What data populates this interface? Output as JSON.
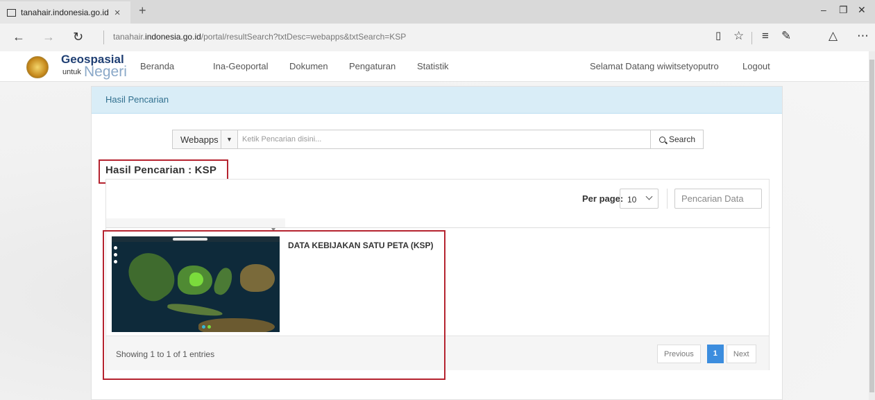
{
  "browser": {
    "tab_title": "tanahair.indonesia.go.id",
    "url_prefix": "tanahair.",
    "url_domain": "indonesia.go.id",
    "url_path": "/portal/resultSearch?txtDesc=webapps&txtSearch=KSP"
  },
  "site": {
    "brand_line1": "Geospasial",
    "brand_line2": "untuk",
    "brand_line3": "Negeri",
    "menu": [
      "Beranda",
      "Ina-Geoportal",
      "Dokumen",
      "Pengaturan",
      "Statistik"
    ],
    "welcome": "Selamat Datang wiwitsetyoputro",
    "logout": "Logout"
  },
  "card": {
    "header": "Hasil Pencarian",
    "search_type": "Webapps",
    "search_placeholder": "Ketik Pencarian disini...",
    "search_button": "Search",
    "result_title": "Hasil Pencarian : KSP"
  },
  "table": {
    "per_page_label": "Per page:",
    "per_page_value": "10",
    "data_search_placeholder": "Pencarian Data",
    "results": [
      {
        "title": "DATA KEBIJAKAN SATU PETA (KSP)"
      }
    ],
    "showing": "Showing 1 to 1 of 1 entries",
    "pagination": {
      "previous": "Previous",
      "current": "1",
      "next": "Next"
    }
  },
  "colors": {
    "accent": "#3c8dde",
    "highlight_box": "#b5232f",
    "panel_header_bg": "#d9edf7"
  }
}
